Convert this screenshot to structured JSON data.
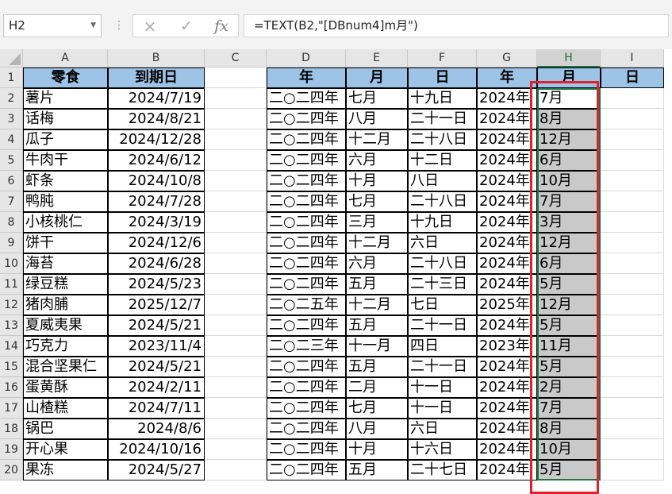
{
  "formula_bar": {
    "name_box": "H2",
    "formula": "=TEXT(B2,\"[DBnum4]m月\")",
    "cancel_icon": "×",
    "enter_icon": "✓",
    "insert_function_icon": "fx"
  },
  "columns": [
    "A",
    "B",
    "C",
    "D",
    "E",
    "F",
    "G",
    "H",
    "I"
  ],
  "selected_column": "H",
  "header_row": {
    "A": "零食",
    "B": "到期日",
    "C": "",
    "D": "年",
    "E": "月",
    "F": "日",
    "G": "年",
    "H": "月",
    "I": "日"
  },
  "rows": [
    {
      "num": "2",
      "A": "薯片",
      "B": "2024/7/19",
      "D": "二○二四年",
      "E": "七月",
      "F": "十九日",
      "G": "2024年",
      "H": "7月"
    },
    {
      "num": "3",
      "A": "话梅",
      "B": "2024/8/21",
      "D": "二○二四年",
      "E": "八月",
      "F": "二十一日",
      "G": "2024年",
      "H": "8月"
    },
    {
      "num": "4",
      "A": "瓜子",
      "B": "2024/12/28",
      "D": "二○二四年",
      "E": "十二月",
      "F": "二十八日",
      "G": "2024年",
      "H": "12月"
    },
    {
      "num": "5",
      "A": "牛肉干",
      "B": "2024/6/12",
      "D": "二○二四年",
      "E": "六月",
      "F": "十二日",
      "G": "2024年",
      "H": "6月"
    },
    {
      "num": "6",
      "A": "虾条",
      "B": "2024/10/8",
      "D": "二○二四年",
      "E": "十月",
      "F": "八日",
      "G": "2024年",
      "H": "10月"
    },
    {
      "num": "7",
      "A": "鸭肫",
      "B": "2024/7/28",
      "D": "二○二四年",
      "E": "七月",
      "F": "二十八日",
      "G": "2024年",
      "H": "7月"
    },
    {
      "num": "8",
      "A": "小核桃仁",
      "B": "2024/3/19",
      "D": "二○二四年",
      "E": "三月",
      "F": "十九日",
      "G": "2024年",
      "H": "3月"
    },
    {
      "num": "9",
      "A": "饼干",
      "B": "2024/12/6",
      "D": "二○二四年",
      "E": "十二月",
      "F": "六日",
      "G": "2024年",
      "H": "12月"
    },
    {
      "num": "10",
      "A": "海苔",
      "B": "2024/6/28",
      "D": "二○二四年",
      "E": "六月",
      "F": "二十八日",
      "G": "2024年",
      "H": "6月"
    },
    {
      "num": "11",
      "A": "绿豆糕",
      "B": "2024/5/23",
      "D": "二○二四年",
      "E": "五月",
      "F": "二十三日",
      "G": "2024年",
      "H": "5月"
    },
    {
      "num": "12",
      "A": "猪肉脯",
      "B": "2025/12/7",
      "D": "二○二五年",
      "E": "十二月",
      "F": "七日",
      "G": "2025年",
      "H": "12月"
    },
    {
      "num": "13",
      "A": "夏威夷果",
      "B": "2024/5/21",
      "D": "二○二四年",
      "E": "五月",
      "F": "二十一日",
      "G": "2024年",
      "H": "5月"
    },
    {
      "num": "14",
      "A": "巧克力",
      "B": "2023/11/4",
      "D": "二○二三年",
      "E": "十一月",
      "F": "四日",
      "G": "2023年",
      "H": "11月"
    },
    {
      "num": "15",
      "A": "混合坚果仁",
      "B": "2024/5/21",
      "D": "二○二四年",
      "E": "五月",
      "F": "二十一日",
      "G": "2024年",
      "H": "5月"
    },
    {
      "num": "16",
      "A": "蛋黄酥",
      "B": "2024/2/11",
      "D": "二○二四年",
      "E": "二月",
      "F": "十一日",
      "G": "2024年",
      "H": "2月"
    },
    {
      "num": "17",
      "A": "山楂糕",
      "B": "2024/7/11",
      "D": "二○二四年",
      "E": "七月",
      "F": "十一日",
      "G": "2024年",
      "H": "7月"
    },
    {
      "num": "18",
      "A": "锅巴",
      "B": "2024/8/6",
      "D": "二○二四年",
      "E": "八月",
      "F": "六日",
      "G": "2024年",
      "H": "8月"
    },
    {
      "num": "19",
      "A": "开心果",
      "B": "2024/10/16",
      "D": "二○二四年",
      "E": "十月",
      "F": "十六日",
      "G": "2024年",
      "H": "10月"
    },
    {
      "num": "20",
      "A": "果冻",
      "B": "2024/5/27",
      "D": "二○二四年",
      "E": "五月",
      "F": "二十七日",
      "G": "2024年",
      "H": "5月"
    }
  ],
  "colors": {
    "header_fill": "#9dc3e6",
    "selection_green": "#217346",
    "highlight_red": "#e0202a"
  }
}
